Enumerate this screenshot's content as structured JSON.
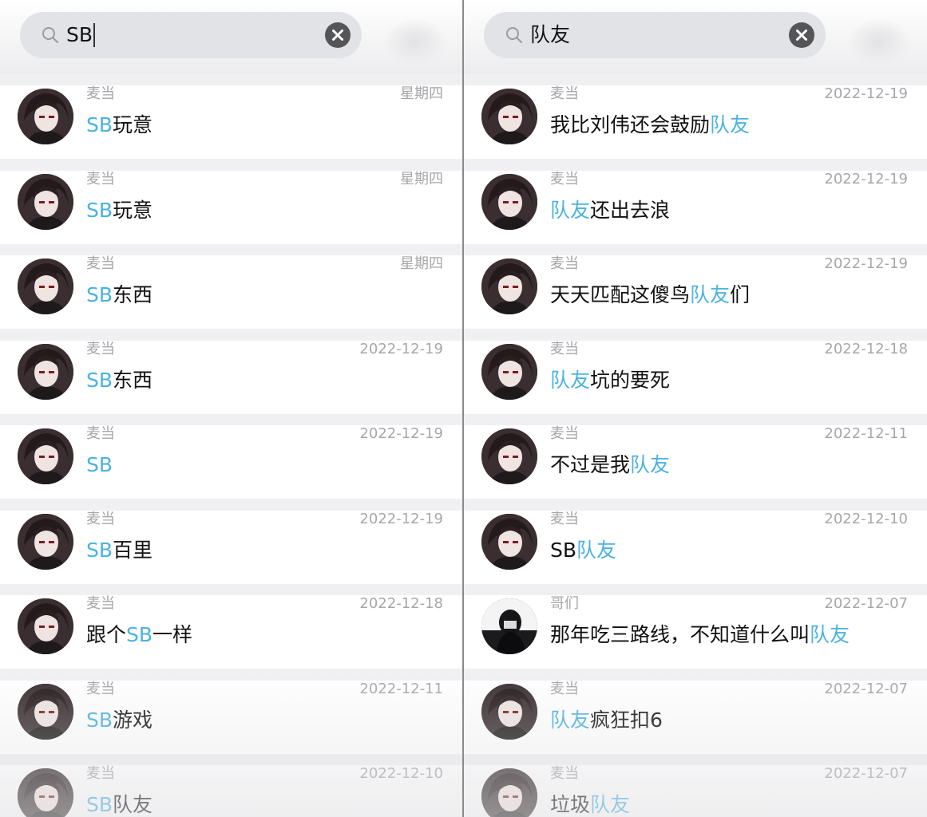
{
  "left": {
    "search": {
      "query": "SB"
    },
    "results": [
      {
        "name": "麦当",
        "date": "星期四",
        "parts": [
          {
            "t": "SB",
            "h": true
          },
          {
            "t": "玩意",
            "h": false
          }
        ]
      },
      {
        "name": "麦当",
        "date": "星期四",
        "parts": [
          {
            "t": "SB",
            "h": true
          },
          {
            "t": "玩意",
            "h": false
          }
        ]
      },
      {
        "name": "麦当",
        "date": "星期四",
        "parts": [
          {
            "t": "SB",
            "h": true
          },
          {
            "t": "东西",
            "h": false
          }
        ]
      },
      {
        "name": "麦当",
        "date": "2022-12-19",
        "parts": [
          {
            "t": "SB",
            "h": true
          },
          {
            "t": "东西",
            "h": false
          }
        ]
      },
      {
        "name": "麦当",
        "date": "2022-12-19",
        "parts": [
          {
            "t": "SB",
            "h": true
          }
        ]
      },
      {
        "name": "麦当",
        "date": "2022-12-19",
        "parts": [
          {
            "t": "SB",
            "h": true
          },
          {
            "t": "百里",
            "h": false
          }
        ]
      },
      {
        "name": "麦当",
        "date": "2022-12-18",
        "parts": [
          {
            "t": "跟个",
            "h": false
          },
          {
            "t": "SB",
            "h": true
          },
          {
            "t": "一样",
            "h": false
          }
        ]
      },
      {
        "name": "麦当",
        "date": "2022-12-11",
        "parts": [
          {
            "t": "SB",
            "h": true
          },
          {
            "t": "游戏",
            "h": false
          }
        ]
      },
      {
        "name": "麦当",
        "date": "2022-12-10",
        "parts": [
          {
            "t": "SB",
            "h": true
          },
          {
            "t": "队友",
            "h": false
          }
        ]
      }
    ]
  },
  "right": {
    "search": {
      "query": "队友"
    },
    "results": [
      {
        "name": "麦当",
        "date": "2022-12-19",
        "parts": [
          {
            "t": "我比刘伟还会鼓励",
            "h": false
          },
          {
            "t": "队友",
            "h": true
          }
        ]
      },
      {
        "name": "麦当",
        "date": "2022-12-19",
        "parts": [
          {
            "t": "队友",
            "h": true
          },
          {
            "t": "还出去浪",
            "h": false
          }
        ]
      },
      {
        "name": "麦当",
        "date": "2022-12-19",
        "parts": [
          {
            "t": "天天匹配这傻鸟",
            "h": false
          },
          {
            "t": "队友",
            "h": true
          },
          {
            "t": "们",
            "h": false
          }
        ]
      },
      {
        "name": "麦当",
        "date": "2022-12-18",
        "parts": [
          {
            "t": "队友",
            "h": true
          },
          {
            "t": "坑的要死",
            "h": false
          }
        ]
      },
      {
        "name": "麦当",
        "date": "2022-12-11",
        "parts": [
          {
            "t": "不过是我",
            "h": false
          },
          {
            "t": "队友",
            "h": true
          }
        ]
      },
      {
        "name": "麦当",
        "date": "2022-12-10",
        "parts": [
          {
            "t": "SB",
            "h": false
          },
          {
            "t": "队友",
            "h": true
          }
        ]
      },
      {
        "name": "哥们",
        "date": "2022-12-07",
        "avatar": "dark",
        "parts": [
          {
            "t": "那年吃三路线，不知道什么叫",
            "h": false
          },
          {
            "t": "队友",
            "h": true
          }
        ]
      },
      {
        "name": "麦当",
        "date": "2022-12-07",
        "parts": [
          {
            "t": "队友",
            "h": true
          },
          {
            "t": "疯狂扣6",
            "h": false
          }
        ]
      },
      {
        "name": "麦当",
        "date": "2022-12-07",
        "parts": [
          {
            "t": "垃圾",
            "h": false
          },
          {
            "t": "队友",
            "h": true
          }
        ]
      }
    ]
  },
  "icons": {
    "search": "search-icon",
    "clear": "clear-icon",
    "avatar": "avatar"
  },
  "colors": {
    "highlight": "#4bb2e0",
    "meta": "#a7a7a7",
    "text": "#111111",
    "row_bg": "#ffffff",
    "gap_bg": "#f0f0f2",
    "search_bg": "#e2e3e7"
  }
}
